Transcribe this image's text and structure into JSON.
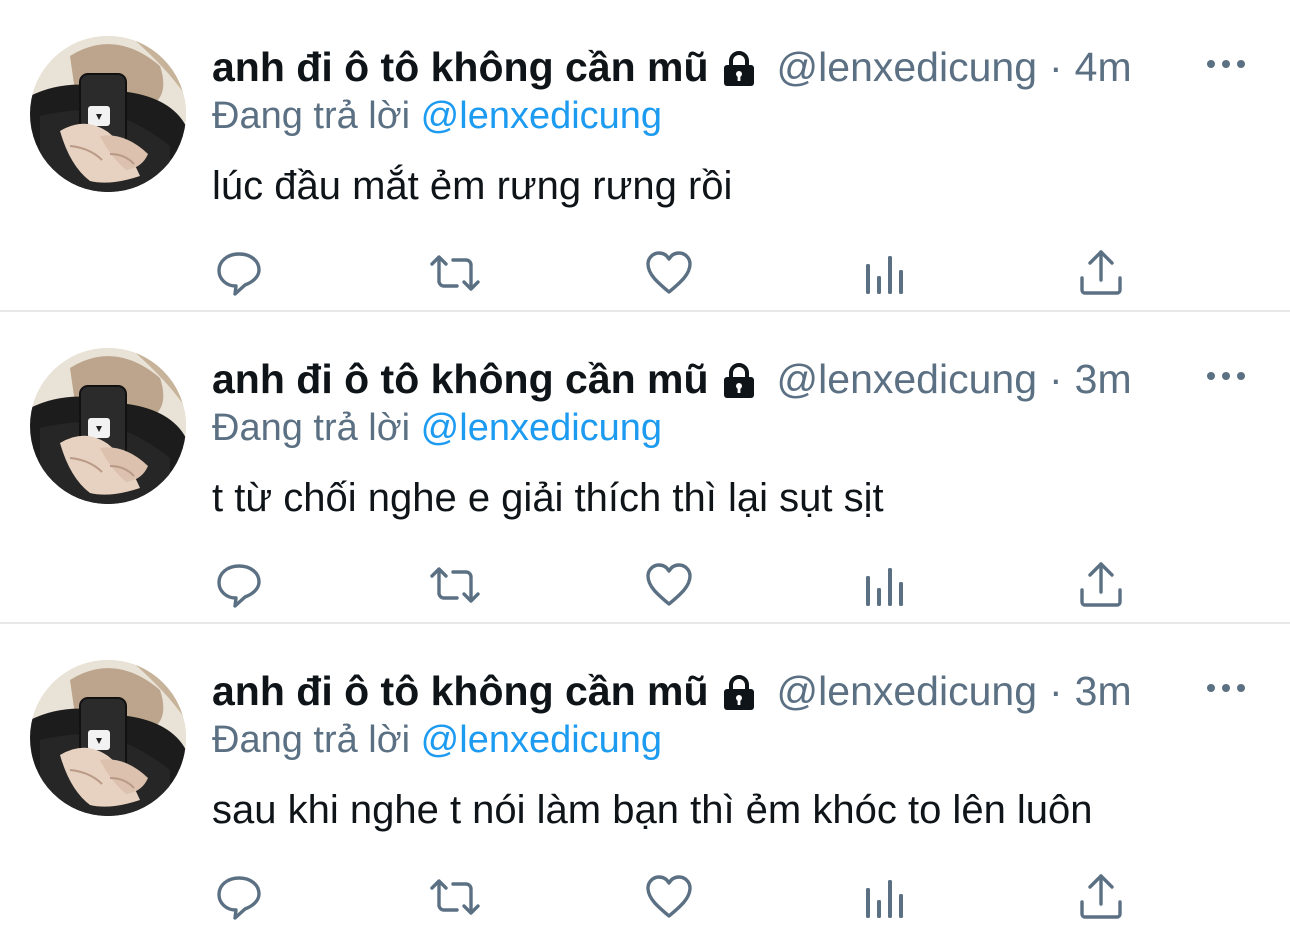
{
  "colors": {
    "text_primary": "#0f1419",
    "text_secondary": "#5b7083",
    "mention": "#1d9bf0",
    "icon": "#5b7083",
    "divider": "#e6e8ea"
  },
  "icons": {
    "lock": "lock-icon",
    "more": "more-dots-icon",
    "reply": "reply-bubble-icon",
    "retweet": "retweet-icon",
    "like": "heart-icon",
    "stats": "analytics-bars-icon",
    "share": "share-upload-icon"
  },
  "tweets": [
    {
      "author_name": "anh đi ô tô không cần mũ",
      "handle": "@lenxedicung",
      "separator": "·",
      "time": "4m",
      "reply_prefix": "Đang trả lời",
      "reply_to": "@lenxedicung",
      "text": "lúc đầu mắt ẻm rưng rưng rồi"
    },
    {
      "author_name": "anh đi ô tô không cần mũ",
      "handle": "@lenxedicung",
      "separator": "·",
      "time": "3m",
      "reply_prefix": "Đang trả lời",
      "reply_to": "@lenxedicung",
      "text": "t từ chối nghe e giải thích thì lại sụt sịt"
    },
    {
      "author_name": "anh đi ô tô không cần mũ",
      "handle": "@lenxedicung",
      "separator": "·",
      "time": "3m",
      "reply_prefix": "Đang trả lời",
      "reply_to": "@lenxedicung",
      "text": "sau khi nghe t nói làm bạn thì ẻm khóc to lên luôn"
    }
  ]
}
